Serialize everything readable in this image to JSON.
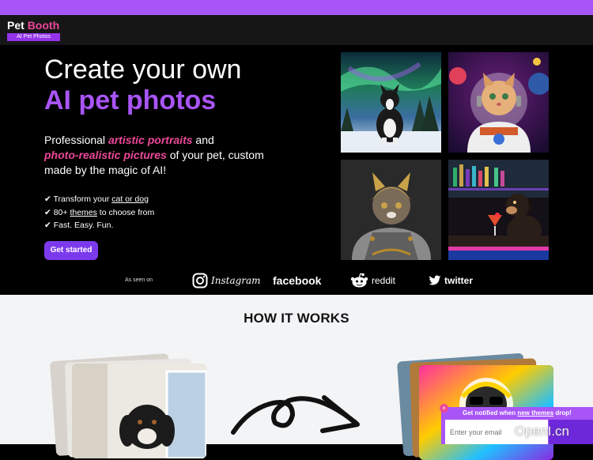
{
  "header": {
    "logo_part1": "Pet",
    "logo_part2": "Booth",
    "logo_subtitle": "AI Pet Photos"
  },
  "hero": {
    "title_line1": "Create your own",
    "title_line2": "AI pet photos",
    "lead_1": "Professional ",
    "lead_em1": "artistic portraits",
    "lead_2": " and ",
    "lead_em2": "photo-realistic pictures",
    "lead_3": " of your pet, custom made by the magic of AI!",
    "check1_prefix": "✔ Transform your ",
    "check1_link": "cat or dog",
    "check2_prefix": "✔ 80+ ",
    "check2_link": "themes",
    "check2_suffix": " to choose from",
    "check3": "✔ Fast. Easy. Fun.",
    "cta_label": "Get started"
  },
  "press": {
    "label": "As seen on",
    "brands": [
      "Instagram",
      "facebook",
      "reddit",
      "twitter"
    ]
  },
  "how": {
    "title": "HOW IT WORKS"
  },
  "notify": {
    "close": "×",
    "text_prefix": "Get notified when ",
    "text_link": "new themes",
    "text_suffix": " drop!",
    "email_placeholder": "Enter your email"
  },
  "watermark": "OpenI.cn",
  "colors": {
    "accent": "#a855f7",
    "pink": "#ec4899",
    "button": "#7c3aed"
  }
}
